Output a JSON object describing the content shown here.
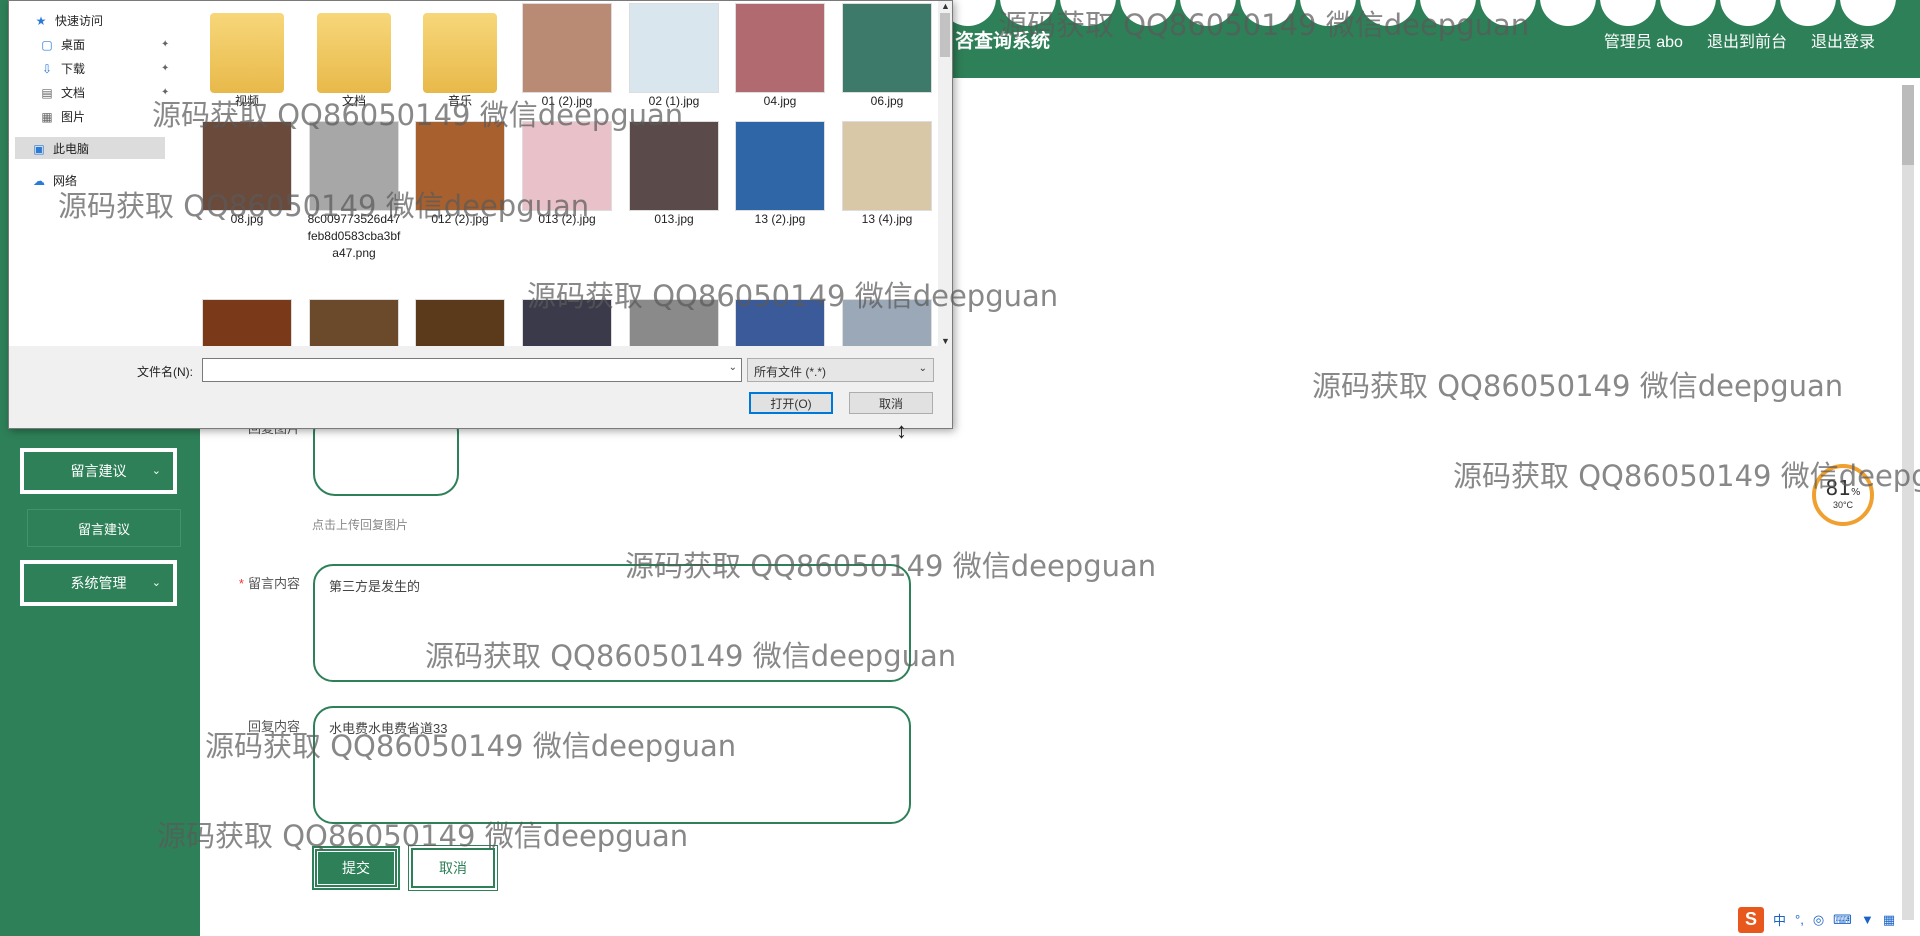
{
  "header": {
    "title_partial": "咨查询系统",
    "links": [
      "管理员 abo",
      "退出到前台",
      "退出登录"
    ]
  },
  "sidebar": {
    "menus": [
      {
        "label": "留言建议",
        "chevron": "chevron-down-icon"
      },
      {
        "label": "系统管理",
        "chevron": "chevron-down-icon"
      }
    ],
    "sub_items": [
      "留言建议"
    ]
  },
  "form": {
    "reply_image_label": "回复图片",
    "upload_hint": "点击上传回复图片",
    "message_label": "留言内容",
    "message_value": "第三方是发生的",
    "reply_label": "回复内容",
    "reply_value": "水电费水电费省道33",
    "submit": "提交",
    "cancel": "取消"
  },
  "gauge": {
    "percent": "81",
    "unit": "%",
    "temp": "30°C"
  },
  "file_dialog": {
    "nav": [
      {
        "label": "快速访问",
        "icon": "star-icon"
      },
      {
        "label": "桌面",
        "icon": "desktop-icon",
        "pinned": true
      },
      {
        "label": "下载",
        "icon": "download-icon",
        "pinned": true
      },
      {
        "label": "文档",
        "icon": "document-icon",
        "pinned": true
      },
      {
        "label": "图片",
        "icon": "picture-icon",
        "pinned": true
      },
      {
        "label": "此电脑",
        "icon": "computer-icon"
      },
      {
        "label": "网络",
        "icon": "network-icon"
      }
    ],
    "files": [
      {
        "name": "视频",
        "kind": "folder-video"
      },
      {
        "name": "文档",
        "kind": "folder-doc"
      },
      {
        "name": "音乐",
        "kind": "folder-music"
      },
      {
        "name": "01 (2).jpg",
        "kind": "photo",
        "color": "#b98b74"
      },
      {
        "name": "02 (1).jpg",
        "kind": "photo",
        "color": "#d9e6ee"
      },
      {
        "name": "04.jpg",
        "kind": "photo",
        "color": "#b06a70"
      },
      {
        "name": "06.jpg",
        "kind": "photo",
        "color": "#3e7a6a"
      },
      {
        "name": "08.jpg",
        "kind": "photo",
        "color": "#6a4a3a"
      },
      {
        "name": "8c009773526d47feb8d0583cba3bfa47.png",
        "kind": "photo",
        "color": "#a7a7a7"
      },
      {
        "name": "012 (2).jpg",
        "kind": "photo",
        "color": "#a8602e"
      },
      {
        "name": "013 (2).jpg",
        "kind": "photo",
        "color": "#e8c2c8"
      },
      {
        "name": "013.jpg",
        "kind": "photo",
        "color": "#5a4a4a"
      },
      {
        "name": "13 (2).jpg",
        "kind": "photo",
        "color": "#2e66a8"
      },
      {
        "name": "13 (4).jpg",
        "kind": "photo",
        "color": "#d8c8a8"
      },
      {
        "name": "",
        "kind": "photo",
        "color": "#7a3a1a"
      },
      {
        "name": "",
        "kind": "photo",
        "color": "#6a4a2a"
      },
      {
        "name": "",
        "kind": "photo",
        "color": "#5a3a1a"
      },
      {
        "name": "",
        "kind": "photo",
        "color": "#3a3a4a"
      },
      {
        "name": "",
        "kind": "photo",
        "color": "#8a8a8a"
      },
      {
        "name": "",
        "kind": "photo",
        "color": "#3a5a9a"
      },
      {
        "name": "",
        "kind": "photo",
        "color": "#9aa8b8"
      }
    ],
    "filename_label": "文件名(N):",
    "filename_value": "",
    "filetype": "所有文件 (*.*)",
    "open_button": "打开(O)",
    "cancel_button": "取消"
  },
  "watermark": "源码获取 QQ86050149 微信deepguan",
  "tray": [
    "中",
    "°,",
    "mic-icon",
    "keyboard-icon",
    "shirt-icon",
    "grid-icon"
  ],
  "colors": {
    "brand_green": "#2e8058",
    "accent_orange": "#f0a030"
  }
}
